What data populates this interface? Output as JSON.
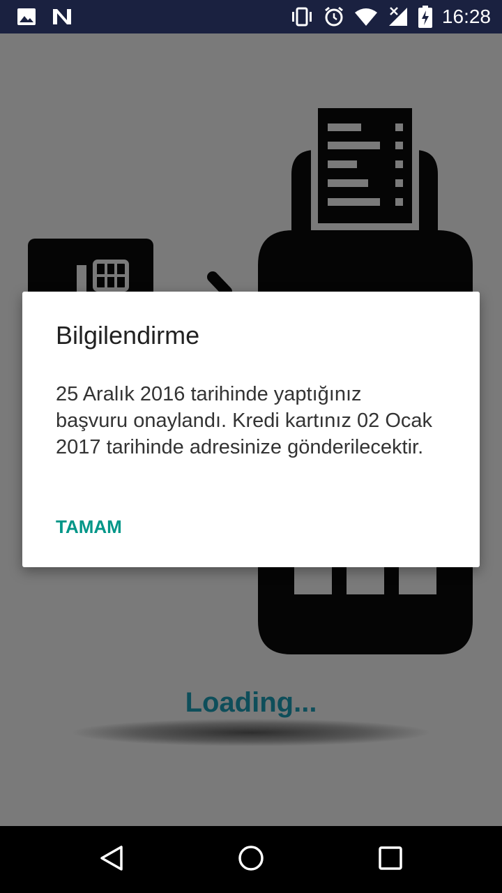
{
  "status_bar": {
    "time": "16:28",
    "left_icons": [
      "image-icon",
      "n-notification-icon"
    ],
    "right_icons": [
      "vibrate-icon",
      "alarm-icon",
      "wifi-icon",
      "signal-icon",
      "battery-charging-icon"
    ]
  },
  "background": {
    "loading_text": "Loading...",
    "loading_color": "#0e4e5a"
  },
  "dialog": {
    "title": "Bilgilendirme",
    "message": "25 Aralık 2016 tarihinde yaptığınız başvuru onaylandı. Kredi kartınız 02 Ocak 2017 tarihinde adresinize gönderilecektir.",
    "button_label": "TAMAM",
    "accent_color": "#009688"
  },
  "nav_bar": {
    "buttons": [
      "back-icon",
      "home-icon",
      "recents-icon"
    ]
  }
}
